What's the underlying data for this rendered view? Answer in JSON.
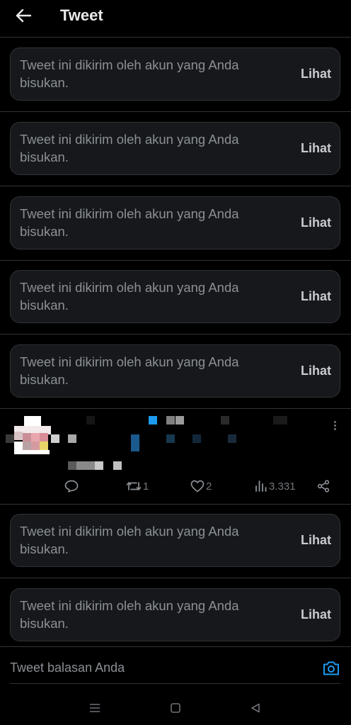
{
  "header": {
    "title": "Tweet",
    "back_icon": "arrow-left-icon"
  },
  "muted_cards": [
    {
      "text": "Tweet ini dikirim oleh akun yang Anda bisukan.",
      "action": "Lihat"
    },
    {
      "text": "Tweet ini dikirim oleh akun yang Anda bisukan.",
      "action": "Lihat"
    },
    {
      "text": "Tweet ini dikirim oleh akun yang Anda bisukan.",
      "action": "Lihat"
    },
    {
      "text": "Tweet ini dikirim oleh akun yang Anda bisukan.",
      "action": "Lihat"
    },
    {
      "text": "Tweet ini dikirim oleh akun yang Anda bisukan.",
      "action": "Lihat"
    },
    {
      "text": "Tweet ini dikirim oleh akun yang Anda bisukan.",
      "action": "Lihat"
    },
    {
      "text": "Tweet ini dikirim oleh akun yang Anda bisukan.",
      "action": "Lihat"
    }
  ],
  "tweet": {
    "retweet_count": "1",
    "like_count": "2",
    "view_count": "3.331"
  },
  "reply": {
    "placeholder": "Tweet balasan Anda"
  },
  "colors": {
    "background": "#000000",
    "card": "#16181c",
    "accent": "#1d9bf0",
    "muted_text": "#8b9095"
  }
}
